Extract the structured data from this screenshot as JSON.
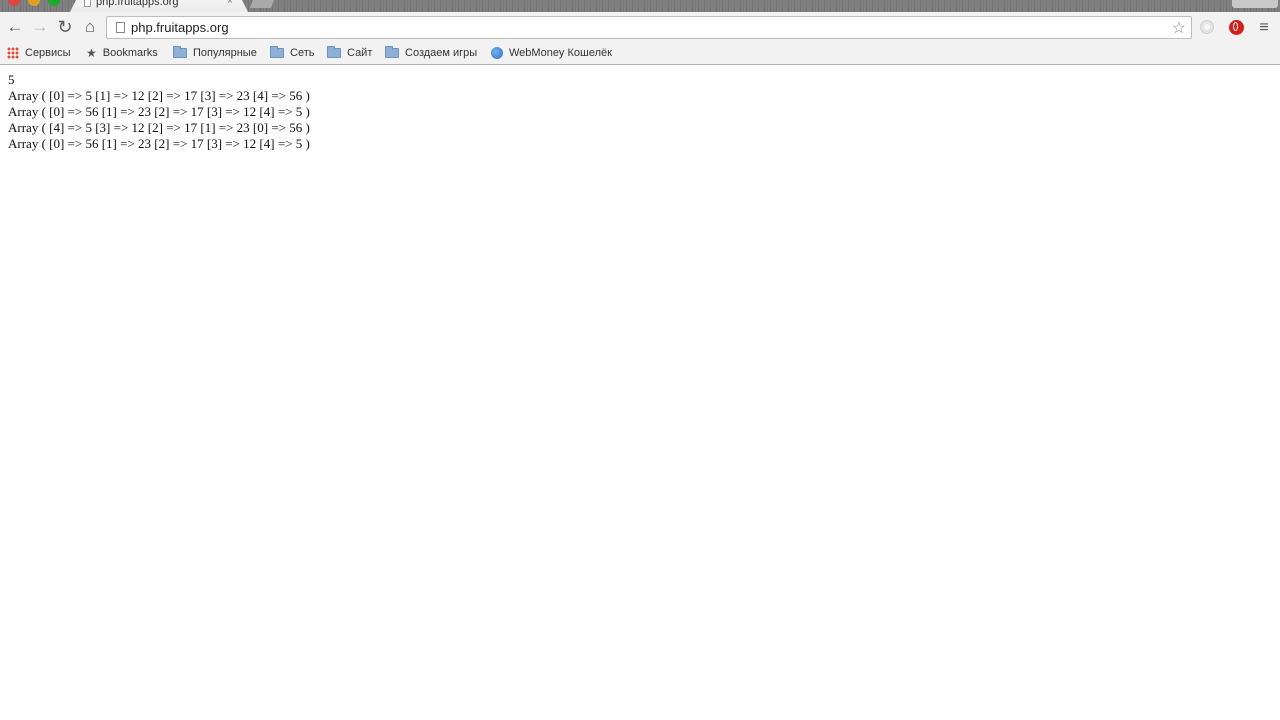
{
  "tab": {
    "title": "php.fruitapps.org",
    "close_glyph": "×"
  },
  "toolbar": {
    "back_glyph": "←",
    "forward_glyph": "→",
    "reload_glyph": "↻",
    "home_glyph": "⌂",
    "url": "php.fruitapps.org",
    "star_glyph": "☆",
    "menu_glyph": "≡"
  },
  "bookmarks": {
    "items": [
      {
        "label": "Сервисы",
        "icon": "apps-grid-icon"
      },
      {
        "label": "Bookmarks",
        "icon": "star-icon"
      },
      {
        "label": "Популярные",
        "icon": "folder-icon"
      },
      {
        "label": "Сеть",
        "icon": "folder-icon"
      },
      {
        "label": "Сайт",
        "icon": "folder-icon"
      },
      {
        "label": "Создаем игры",
        "icon": "folder-icon"
      },
      {
        "label": "WebMoney Кошелёк",
        "icon": "globe-icon"
      }
    ],
    "star_glyph": "★"
  },
  "content": {
    "lines": [
      "5",
      "Array ( [0] => 5 [1] => 12 [2] => 17 [3] => 23 [4] => 56 )",
      "Array ( [0] => 56 [1] => 23 [2] => 17 [3] => 12 [4] => 5 )",
      "Array ( [4] => 5 [3] => 12 [2] => 17 [1] => 23 [0] => 56 )",
      "Array ( [0] => 56 [1] => 23 [2] => 17 [3] => 12 [4] => 5 )"
    ]
  },
  "colors": {
    "chrome_bg": "#f2f2f2",
    "opera_red": "#d3221b",
    "apps_red": "#e34b3d"
  }
}
